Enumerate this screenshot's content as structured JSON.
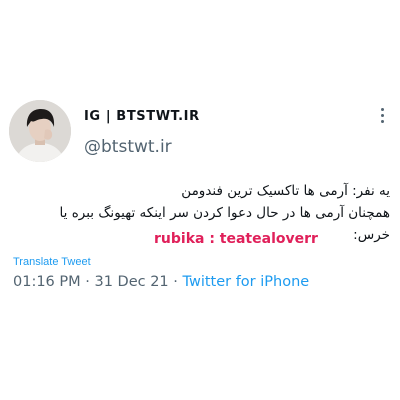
{
  "tweet": {
    "display_name": "IG | BTSTWT.IR",
    "handle": "@btstwt.ir",
    "text_lines": [
      "یه نفر: آرمی ها تاکسیک ترین فندومن",
      "همچنان آرمی ها در حال دعوا کردن سر اینکه تهیونگ ببره یا",
      "خرس:"
    ],
    "watermark": "rubika : teatealoverr",
    "translate_label": "Translate Tweet",
    "time": "01:16 PM",
    "date": "31 Dec 21",
    "separator": "·",
    "source": "Twitter for iPhone"
  },
  "icons": {
    "menu": "more-vertical-icon",
    "avatar": "profile-photo"
  },
  "colors": {
    "text": "#0f1419",
    "secondary": "#536471",
    "link": "#1d9bf0",
    "watermark": "#e0205a"
  }
}
